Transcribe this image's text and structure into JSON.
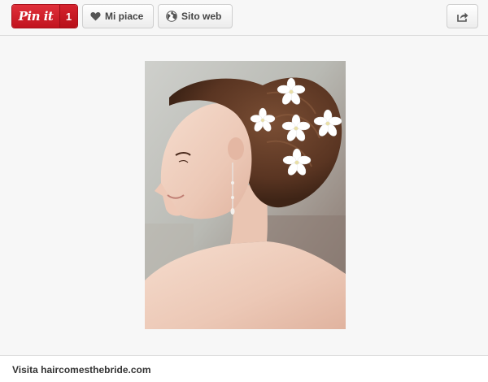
{
  "toolbar": {
    "pinit_label": "Pin it",
    "pin_count": "1",
    "like_label": "Mi piace",
    "website_label": "Sito web",
    "share_icon": "share-icon"
  },
  "image": {
    "subject": "bride-updo-with-white-flowers"
  },
  "footer": {
    "visit_text": "Visita haircomesthebride.com"
  },
  "colors": {
    "pinterest_red": "#cb2027",
    "background": "#f7f7f7"
  }
}
